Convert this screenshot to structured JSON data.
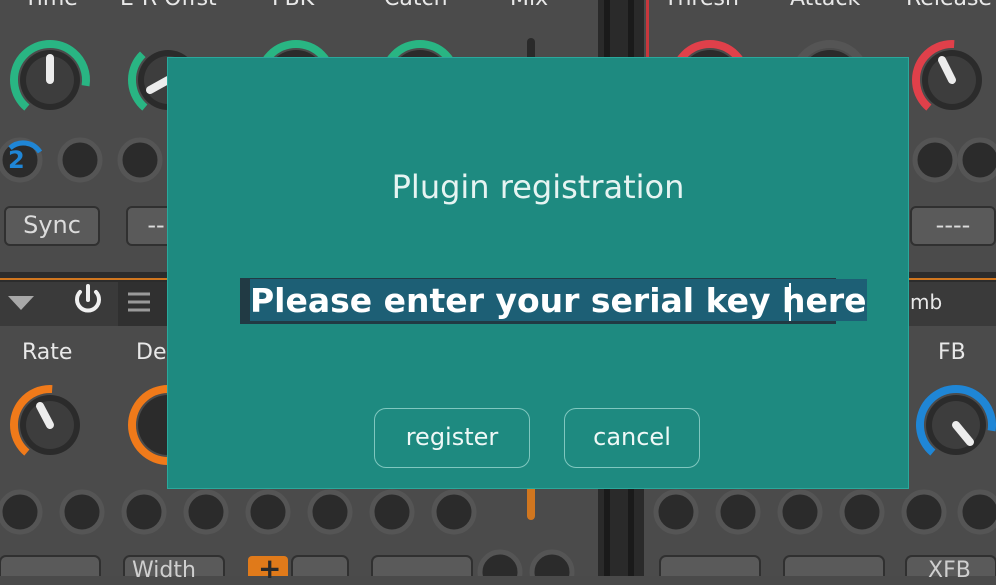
{
  "plugin_background": {
    "top_knob_labels": [
      "Time",
      "E-R Offst",
      "FBK",
      "Catch",
      "Mix",
      "Thresh",
      "Attack",
      "Release"
    ],
    "sync_value": "2",
    "sync_button": "Sync",
    "left_dash_button": "--",
    "right_dash_button": "----",
    "module2_labels": {
      "rate": "Rate",
      "depth": "De",
      "reverb": "mb",
      "fb": "FB"
    },
    "bottom_buttons": {
      "width": "Width",
      "plus": "+",
      "xfb": "XFB"
    }
  },
  "dialog": {
    "title": "Plugin registration",
    "serial_input_value": "Please enter your serial key here",
    "register_label": "register",
    "cancel_label": "cancel"
  },
  "colors": {
    "dialog_bg": "#1e8a80",
    "green_ring": "#29b583",
    "red_ring": "#e0404a",
    "orange_ring": "#f07a1a",
    "blue_ring": "#1f86d6"
  }
}
